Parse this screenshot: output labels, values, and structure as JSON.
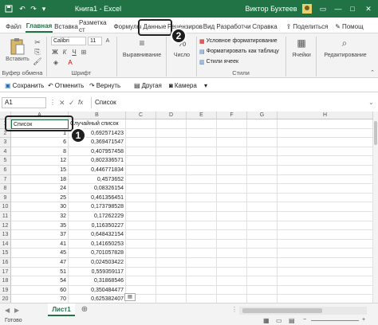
{
  "window": {
    "title": "Книга1 - Excel",
    "user": "Виктор Бухтеев",
    "autosave_icon": "save-icon",
    "undo_icon": "undo-icon",
    "redo_icon": "redo-icon"
  },
  "ribbon_tabs": [
    "Файл",
    "Главная",
    "Вставка",
    "Разметка ст",
    "Формулы",
    "Данные",
    "Рецензиров",
    "Вид",
    "Разработчи",
    "Справка"
  ],
  "ribbon": {
    "paste_label": "Вставить",
    "clipboard_group": "Буфер обмена",
    "font_name": "Calibri",
    "font_size": "11",
    "font_group": "Шрифт",
    "bold": "Ж",
    "italic": "К",
    "underline": "Ч",
    "alignment_label": "Выравнивание",
    "number_label": "Число",
    "cond_format": "Условное форматирование",
    "format_table": "Форматировать как таблицу",
    "cell_styles": "Стили ячеек",
    "styles_group": "Стили",
    "cells_label": "Ячейки",
    "editing_label": "Редактирование",
    "share_label": "Поделиться",
    "help_label": "Помощ"
  },
  "quick_access": {
    "save": "Сохранить",
    "undo": "Отменить",
    "redo": "Вернуть",
    "other": "Другая",
    "camera": "Камера"
  },
  "formula_bar": {
    "name_box": "A1",
    "fx": "fx",
    "value": "Список"
  },
  "columns": [
    "A",
    "B",
    "C",
    "D",
    "E",
    "F",
    "G",
    "H"
  ],
  "rows": [
    {
      "n": "1",
      "a": "Список",
      "b": "Случайный список"
    },
    {
      "n": "2",
      "a": "1",
      "b": "0,692571423"
    },
    {
      "n": "3",
      "a": "6",
      "b": "0,369471547"
    },
    {
      "n": "4",
      "a": "8",
      "b": "0,407957458"
    },
    {
      "n": "5",
      "a": "12",
      "b": "0,802336571"
    },
    {
      "n": "6",
      "a": "15",
      "b": "0,446771834"
    },
    {
      "n": "7",
      "a": "18",
      "b": "0,4573652"
    },
    {
      "n": "8",
      "a": "24",
      "b": "0,08326154"
    },
    {
      "n": "9",
      "a": "25",
      "b": "0,461356451"
    },
    {
      "n": "10",
      "a": "30",
      "b": "0,173798528"
    },
    {
      "n": "11",
      "a": "32",
      "b": "0,17262229"
    },
    {
      "n": "12",
      "a": "35",
      "b": "0,116350227"
    },
    {
      "n": "13",
      "a": "37",
      "b": "0,648432154"
    },
    {
      "n": "14",
      "a": "41",
      "b": "0,141650253"
    },
    {
      "n": "15",
      "a": "45",
      "b": "0,701057828"
    },
    {
      "n": "16",
      "a": "47",
      "b": "0,024503422"
    },
    {
      "n": "17",
      "a": "51",
      "b": "0,559359117"
    },
    {
      "n": "18",
      "a": "54",
      "b": "0,31868546"
    },
    {
      "n": "19",
      "a": "60",
      "b": "0,350484477"
    },
    {
      "n": "20",
      "a": "70",
      "b": "0,625382407"
    },
    {
      "n": "21",
      "a": "",
      "b": ""
    }
  ],
  "sheet_tab": "Лист1",
  "status": "Готово",
  "callouts": [
    "1",
    "2"
  ]
}
